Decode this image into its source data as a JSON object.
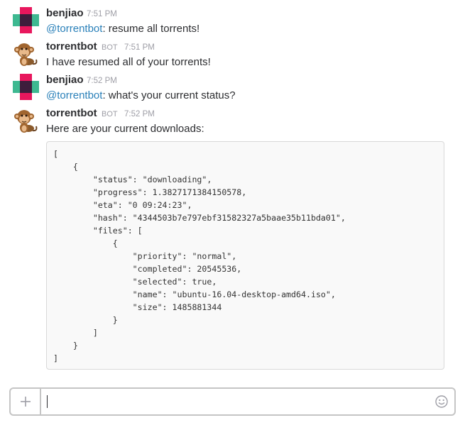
{
  "messages": [
    {
      "user": "benjiao",
      "time": "7:51 PM",
      "mention": "@torrentbot",
      "text": ": resume all torrents!"
    },
    {
      "user": "torrentbot",
      "bot_label": "BOT",
      "time": "7:51 PM",
      "text": "I have resumed all of your torrents!"
    },
    {
      "user": "benjiao",
      "time": "7:52 PM",
      "mention": "@torrentbot",
      "text": ": what's your current status?"
    },
    {
      "user": "torrentbot",
      "bot_label": "BOT",
      "time": "7:52 PM",
      "text": "Here are your current downloads:",
      "code": "[\n    {\n        \"status\": \"downloading\",\n        \"progress\": 1.3827171384150578,\n        \"eta\": \"0 09:24:23\",\n        \"hash\": \"4344503b7e797ebf31582327a5baae35b11bda01\",\n        \"files\": [\n            {\n                \"priority\": \"normal\",\n                \"completed\": 20545536,\n                \"selected\": true,\n                \"name\": \"ubuntu-16.04-desktop-amd64.iso\",\n                \"size\": 1485881344\n            }\n        ]\n    }\n]"
    }
  ],
  "composer": {
    "value": ""
  },
  "icons": {
    "user_avatar": "slack-default-avatar",
    "bot_avatar": "monkey-avatar",
    "attach": "plus-icon",
    "emoji": "smiley-icon"
  }
}
